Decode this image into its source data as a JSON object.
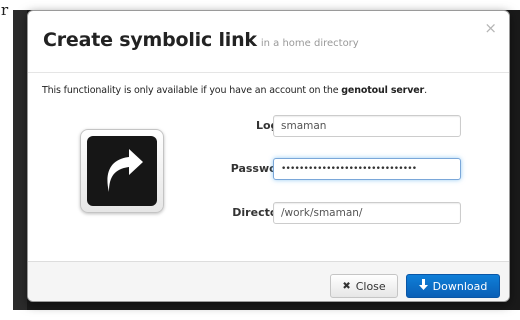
{
  "background": {
    "fragment_text": "r"
  },
  "dialog": {
    "title": "Create symbolic link",
    "subtitle": "in a home directory",
    "close_x": "×",
    "info_prefix": "This functionality is only available if you have an account on the ",
    "info_bold": "genotoul server",
    "info_suffix": ".",
    "icon": "symlink-arrow-icon"
  },
  "form": {
    "login": {
      "label": "Login",
      "value": "smaman"
    },
    "password": {
      "label": "Password",
      "value": "••••••••••••••••••••••••••••••"
    },
    "directory": {
      "label": "Directory",
      "value": "/work/smaman/"
    }
  },
  "footer": {
    "close_label": "Close",
    "close_icon": "✖",
    "download_label": "Download",
    "download_icon": "🡇"
  },
  "colors": {
    "primary": "#0a6fcb",
    "overlay": "#1a1a1a"
  }
}
